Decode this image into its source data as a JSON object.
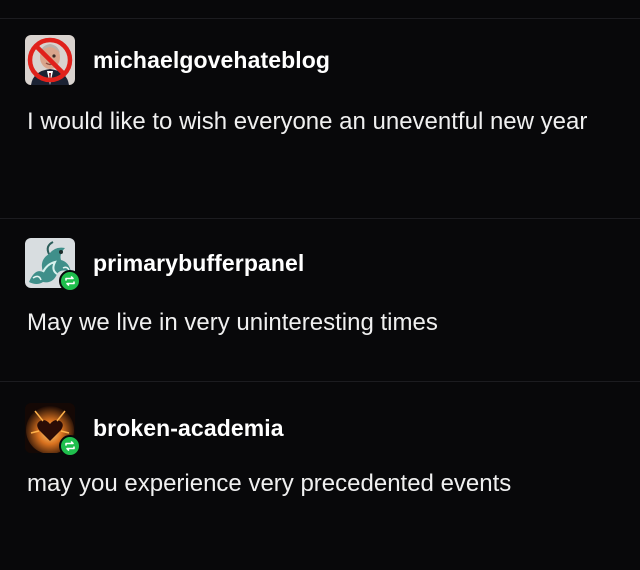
{
  "posts": [
    {
      "username": "michaelgovehateblog",
      "avatar_icon": "crossed-out-portrait-icon",
      "reblog": false,
      "text": "I would like to wish everyone an uneventful new year"
    },
    {
      "username": "primarybufferpanel",
      "avatar_icon": "dragon-artwork-icon",
      "reblog": true,
      "text": "May we live in very uninteresting times"
    },
    {
      "username": "broken-academia",
      "avatar_icon": "burning-heart-icon",
      "reblog": true,
      "text": "may you experience very precedented events"
    }
  ],
  "colors": {
    "background": "#08080a",
    "reblog_badge": "#1fbf4d",
    "ban_red": "#e0211b"
  }
}
